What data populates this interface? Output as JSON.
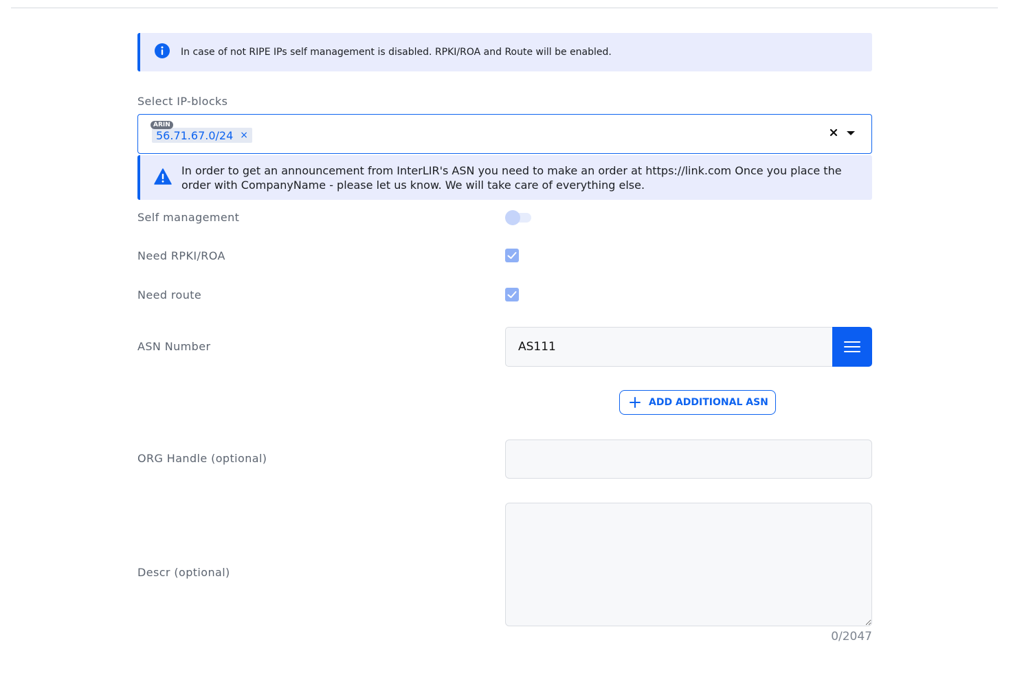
{
  "info_alert": {
    "text": "In case of not RIPE IPs self management is disabled. RPKI/ROA and Route will be enabled."
  },
  "ip_blocks": {
    "label": "Select IP-blocks",
    "selected": [
      {
        "registry": "ARIN",
        "value": "56.71.67.0/24"
      }
    ],
    "remove_glyph": "×",
    "clear_glyph": "✕"
  },
  "warning_alert": {
    "text": "In order to get an announcement from InterLIR's ASN you need to make an order at https://link.com Once you place the order with CompanyName - please let us know. We will take care of everything else."
  },
  "self_management": {
    "label": "Self management",
    "enabled": false
  },
  "need_rpki": {
    "label": "Need RPKI/ROA",
    "checked": true
  },
  "need_route": {
    "label": "Need route",
    "checked": true
  },
  "asn": {
    "label": "ASN Number",
    "value": "AS111",
    "add_button_label": "ADD ADDITIONAL ASN"
  },
  "org_handle": {
    "label": "ORG Handle (optional)",
    "value": ""
  },
  "descr": {
    "label": "Descr (optional)",
    "value": "",
    "counter": "0/2047"
  },
  "colors": {
    "primary": "#0d63f0",
    "alert_bg": "#e9ecfd",
    "checkbox": "#8fb0f6"
  },
  "icons": [
    "info-icon",
    "warning-icon",
    "chip-remove-icon",
    "clear-icon",
    "chevron-down-icon",
    "checkmark-icon",
    "menu-icon",
    "plus-icon"
  ]
}
